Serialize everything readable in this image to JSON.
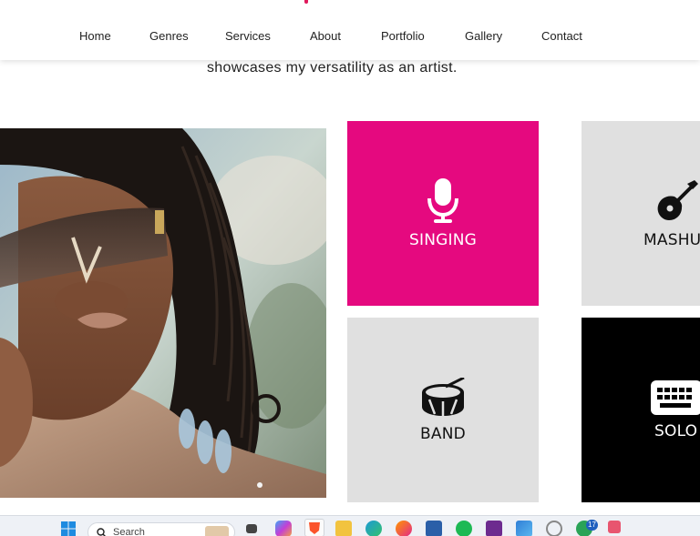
{
  "nav": {
    "items": [
      {
        "label": "Home"
      },
      {
        "label": "Genres"
      },
      {
        "label": "Services"
      },
      {
        "label": "About"
      },
      {
        "label": "Portfolio"
      },
      {
        "label": "Gallery"
      },
      {
        "label": "Contact"
      }
    ]
  },
  "intro": {
    "text": "showcases my versatility as an artist."
  },
  "cards": [
    {
      "label": "SINGING",
      "icon": "microphone-icon"
    },
    {
      "label": "MASHU",
      "icon": "guitar-icon"
    },
    {
      "label": "BAND",
      "icon": "drum-icon"
    },
    {
      "label": "SOLO",
      "icon": "keyboard-icon"
    }
  ],
  "colors": {
    "accent": "#e5097f",
    "card_gray": "#e0e0e0",
    "card_black": "#000000"
  },
  "taskbar": {
    "search_placeholder": "Search",
    "notification_count": "17",
    "icons": [
      "windows-start-icon",
      "search-icon",
      "task-view-icon",
      "copilot-icon",
      "brave-browser-icon",
      "file-explorer-icon",
      "edge-browser-icon",
      "firefox-icon",
      "store-icon",
      "spotify-icon",
      "affinity-icon",
      "photos-icon",
      "hotspot-icon",
      "whatsapp-icon",
      "snipping-tool-icon"
    ]
  }
}
